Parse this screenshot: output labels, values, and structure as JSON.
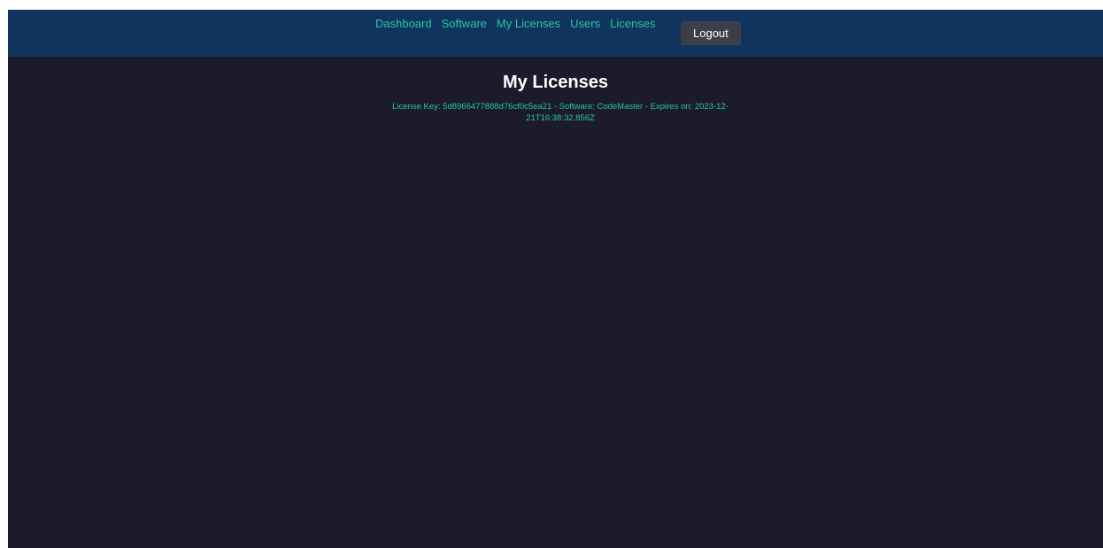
{
  "nav": {
    "links": [
      "Dashboard",
      "Software",
      "My Licenses",
      "Users",
      "Licenses"
    ],
    "logout_label": "Logout"
  },
  "main": {
    "title": "My Licenses",
    "licenses": [
      {
        "text": "License Key: 5d8966477888d76cf0c5ea21 - Software: CodeMaster - Expires on: 2023-12-21T16:38:32.856Z"
      }
    ]
  },
  "colors": {
    "nav_background": "#10345e",
    "page_background": "#1b1b2c",
    "accent": "#27c7a2",
    "button_background": "#3a3f48"
  }
}
